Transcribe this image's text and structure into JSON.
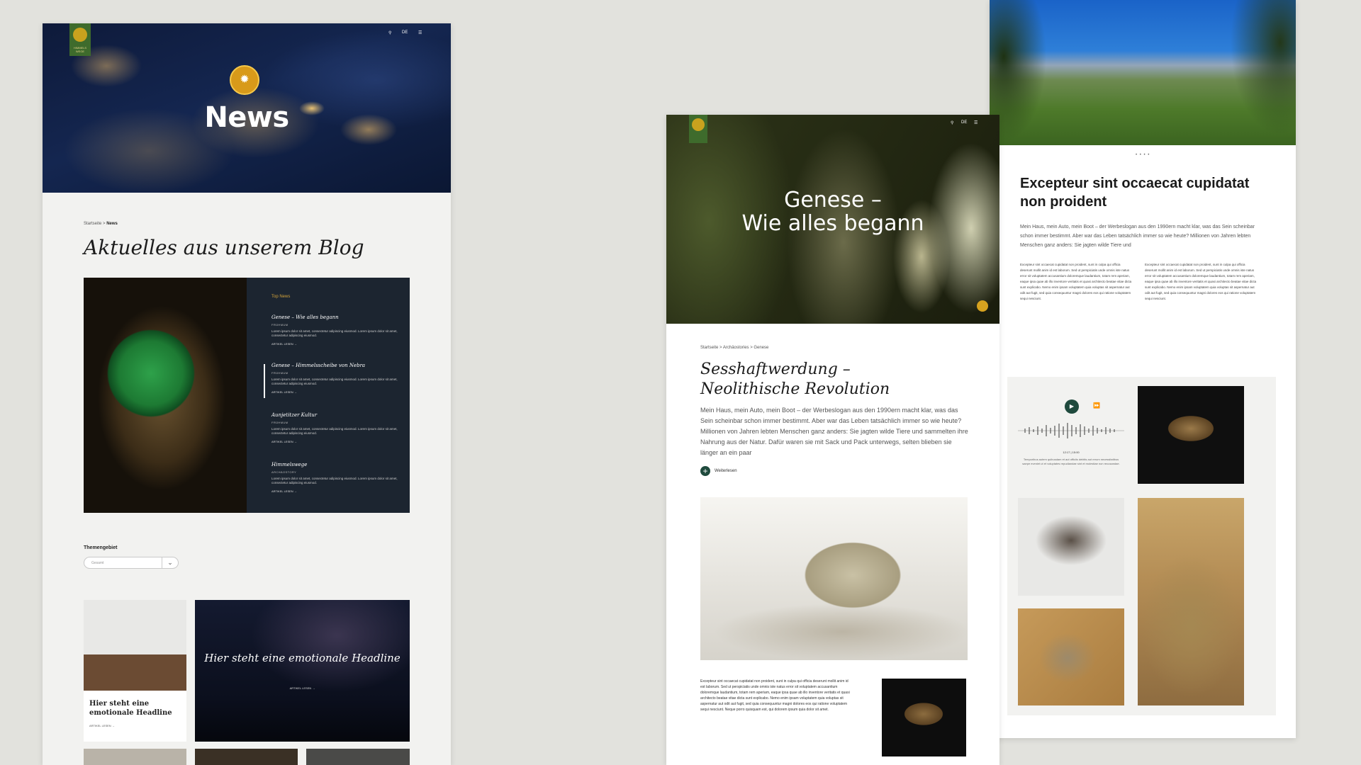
{
  "page1": {
    "nav": {
      "search_icon": "search-icon",
      "lang": "DE",
      "menu_icon": "menu-icon"
    },
    "logo_text": "HIMMELS\nWEGE",
    "hero_title": "News",
    "breadcrumb": {
      "home": "Startseite",
      "sep": ">",
      "current": "News"
    },
    "blog_title": "Aktuelles aus unserem Blog",
    "top_news": {
      "label": "Top News",
      "items": [
        {
          "title": "Genese – Wie alles begann",
          "category": "FRÜHMUM",
          "desc": "Lorem ipsum dolor sit amet, consectetur adipiscing eiusmod. Lorem ipsum dolor sit amet, consectetur adipiscing eiusmod.",
          "read": "ARTIKEL LESEN →"
        },
        {
          "title": "Genese – Himmelsscheibe von Nebra",
          "category": "FRÜHMUM",
          "desc": "Lorem ipsum dolor sit amet, consectetur adipiscing eiusmod. Lorem ipsum dolor sit amet, consectetur adipiscing eiusmod.",
          "read": "ARTIKEL LESEN →"
        },
        {
          "title": "Aunjetitzer Kultur",
          "category": "FRÜHMUM",
          "desc": "Lorem ipsum dolor sit amet, consectetur adipiscing eiusmod. Lorem ipsum dolor sit amet, consectetur adipiscing eiusmod.",
          "read": "ARTIKEL LESEN →"
        },
        {
          "title": "Himmelswege",
          "category": "ARCHÄOSTORY",
          "desc": "Lorem ipsum dolor sit amet, consectetur adipiscing eiusmod. Lorem ipsum dolor sit amet, consectetur adipiscing eiusmod.",
          "read": "ARTIKEL LESEN →"
        }
      ]
    },
    "filter": {
      "label": "Themengebiet",
      "value": "Gesamt"
    },
    "cards": [
      {
        "title": "Hier steht eine emotionale Headline",
        "read": "ARTIKEL LESEN →"
      },
      {
        "title": "Hier steht eine emotionale Headline",
        "read": "ARTIKEL LESEN →"
      }
    ]
  },
  "page2": {
    "hero_title_1": "Genese –",
    "hero_title_2": "Wie alles begann",
    "breadcrumb": "Startseite > Archäostories > Genese",
    "title_1": "Sesshaftwerdung –",
    "title_2": "Neolithische Revolution",
    "intro": "Mein Haus, mein Auto, mein Boot – der Werbeslogan aus den 1990ern macht klar, was das Sein scheinbar schon immer bestimmt. Aber war das Leben tatsächlich immer so wie heute? Millionen von Jahren lebten Menschen ganz anders: Sie jagten wilde Tiere und sammelten ihre Nahrung aus der Natur. Dafür waren sie mit Sack und Pack unterwegs, selten blieben sie länger an ein paar",
    "more_label": "Weiterlesen",
    "body_small": "Excepteur sint occaecat cupidatat non proident, sunt in culpa qui officia deserunt mollit anim id est laborum. Sed ut perspiciatis unde omnis iste natus error sit voluptatem accusantium doloremque laudantium, totam rem aperiam, eaque ipsa quae ab illo inventore veritatis et quasi architecto beatae vitae dicta sunt explicabo. Nemo enim ipsam voluptatem quia voluptas sit aspernatur aut odit aut fugit, sed quia consequuntur magni dolores eos qui ratione voluptatem sequi nesciunt. Neque porro quisquam est, qui dolorem ipsum quia dolor sit amet."
  },
  "page3": {
    "title": "Excepteur sint occaecat cupidatat non proident",
    "intro": "Mein Haus, mein Auto, mein Boot – der Werbeslogan aus den 1990ern macht klar, was das Sein scheinbar schon immer bestimmt. Aber war das Leben tatsächlich immer so wie heute? Millionen von Jahren lebten Menschen ganz anders: Sie jagten wilde Tiere und",
    "col_left": "Excepteur sint occaecat cupidatat non proident, sunt in culpa qui officia deserunt mollit anim id est laborum. Sed ut perspiciatis unde omnis iste natus error sit voluptatem accusantium doloremque laudantium, totam rem aperiam, eaque ipsa quae ab illo inventore veritatis et quasi architecto beatae vitae dicta sunt explicabo. Nemo enim ipsam voluptatem quia voluptas sit aspernatur aut odit aut fugit, sed quia consequuntur magni dolores eos qui ratione voluptatem sequi nesciunt.",
    "col_right": "Excepteur sint occaecat cupidatat non proident, sunt in culpa qui officia deserunt mollit anim id est laborum. Sed ut perspiciatis unde omnis iste natus error sit voluptatem accusantium doloremque laudantium, totam rem aperiam, eaque ipsa quae ab illo inventore veritatis et quasi architecto beatae vitae dicta sunt explicabo. Nemo enim ipsam voluptatem quia voluptas sit aspernatur aut odit aut fugit, sed quia consequuntur magni dolores eos qui ratione voluptatem sequi nesciunt.",
    "slider_dots": "• • • •",
    "audio": {
      "time": "12:17 | 15:00",
      "caption": "Temporibus autem quibusdam et aut officiis debitis aut rerum necessitatibus saepe eveniet ut et voluptates repudiandae sint et molestiae non recusandae."
    }
  }
}
